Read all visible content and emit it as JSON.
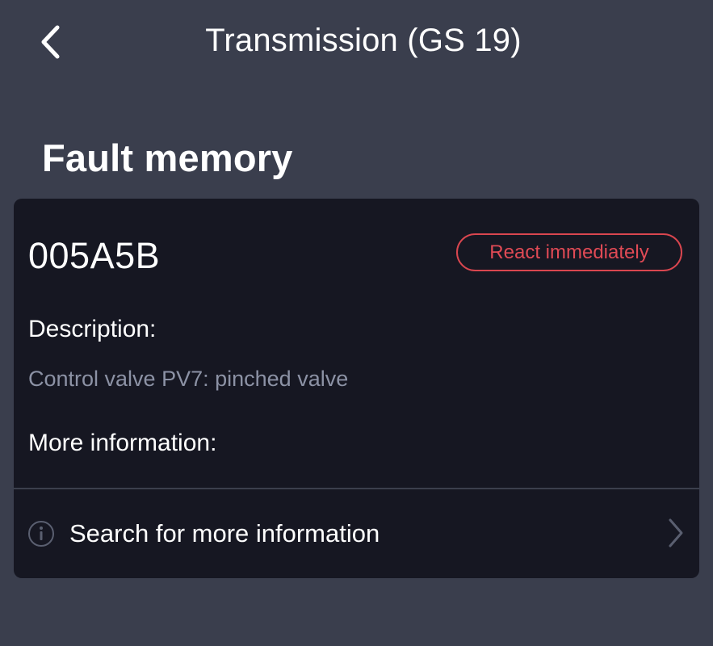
{
  "header": {
    "title": "Transmission (GS 19)"
  },
  "section": {
    "title": "Fault memory"
  },
  "fault": {
    "code": "005A5B",
    "severity": "React immediately",
    "description_label": "Description:",
    "description_value": "Control valve PV7: pinched valve",
    "more_info_label": "More information:",
    "search_label": "Search for more information"
  },
  "icons": {
    "back": "chevron-left-icon",
    "info": "info-circle-icon",
    "forward": "chevron-right-icon"
  },
  "colors": {
    "background": "#3a3e4d",
    "card": "#161722",
    "severity": "#d9464f",
    "secondary_text": "#8c92a5"
  }
}
